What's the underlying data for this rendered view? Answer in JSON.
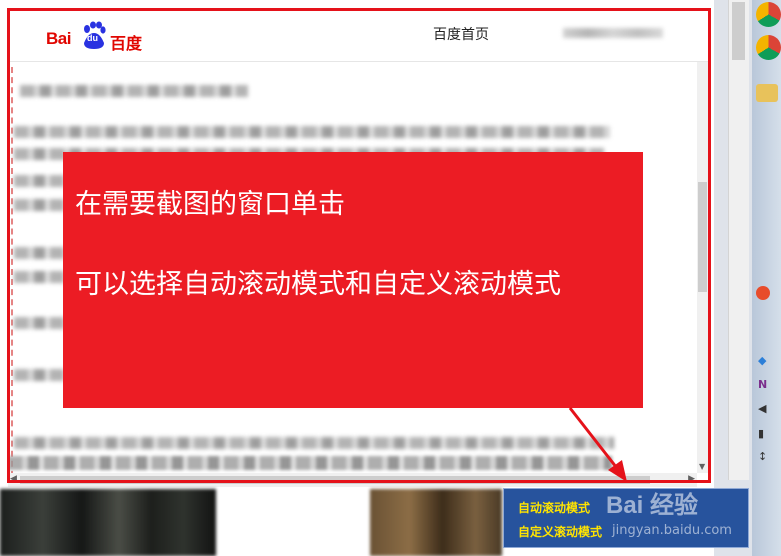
{
  "browser": {
    "logo": {
      "latin": "Bai",
      "paw_text": "du",
      "chinese": "百度"
    },
    "home_link": "百度首页"
  },
  "overlay": {
    "line1": "在需要截图的窗口单击",
    "line2": "可以选择自动滚动模式和自定义滚动模式"
  },
  "popup": {
    "option_auto": "自动滚动模式",
    "option_custom": "自定义滚动模式"
  },
  "watermark": {
    "brand": "Bai 经验",
    "url": "jingyan.baidu.com"
  },
  "colors": {
    "accent_red": "#ec1c24",
    "frame_red": "#e5121a",
    "popup_bg": "#27539d",
    "option_yellow": "#ffe400"
  }
}
